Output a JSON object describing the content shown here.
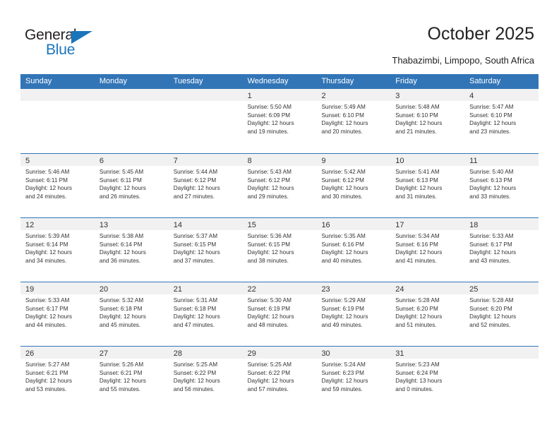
{
  "brand": {
    "name_top": "General",
    "name_bottom": "Blue",
    "accent_color": "#1b75bb"
  },
  "header": {
    "title": "October 2025",
    "subtitle": "Thabazimbi, Limpopo, South Africa"
  },
  "calendar": {
    "header_color": "#3275b7",
    "weekdays": [
      "Sunday",
      "Monday",
      "Tuesday",
      "Wednesday",
      "Thursday",
      "Friday",
      "Saturday"
    ],
    "weeks": [
      [
        {
          "day": "",
          "empty": true
        },
        {
          "day": "",
          "empty": true
        },
        {
          "day": "",
          "empty": true
        },
        {
          "day": "1",
          "sunrise": "Sunrise: 5:50 AM",
          "sunset": "Sunset: 6:09 PM",
          "daylight_line1": "Daylight: 12 hours",
          "daylight_line2": "and 19 minutes."
        },
        {
          "day": "2",
          "sunrise": "Sunrise: 5:49 AM",
          "sunset": "Sunset: 6:10 PM",
          "daylight_line1": "Daylight: 12 hours",
          "daylight_line2": "and 20 minutes."
        },
        {
          "day": "3",
          "sunrise": "Sunrise: 5:48 AM",
          "sunset": "Sunset: 6:10 PM",
          "daylight_line1": "Daylight: 12 hours",
          "daylight_line2": "and 21 minutes."
        },
        {
          "day": "4",
          "sunrise": "Sunrise: 5:47 AM",
          "sunset": "Sunset: 6:10 PM",
          "daylight_line1": "Daylight: 12 hours",
          "daylight_line2": "and 23 minutes."
        }
      ],
      [
        {
          "day": "5",
          "sunrise": "Sunrise: 5:46 AM",
          "sunset": "Sunset: 6:11 PM",
          "daylight_line1": "Daylight: 12 hours",
          "daylight_line2": "and 24 minutes."
        },
        {
          "day": "6",
          "sunrise": "Sunrise: 5:45 AM",
          "sunset": "Sunset: 6:11 PM",
          "daylight_line1": "Daylight: 12 hours",
          "daylight_line2": "and 26 minutes."
        },
        {
          "day": "7",
          "sunrise": "Sunrise: 5:44 AM",
          "sunset": "Sunset: 6:12 PM",
          "daylight_line1": "Daylight: 12 hours",
          "daylight_line2": "and 27 minutes."
        },
        {
          "day": "8",
          "sunrise": "Sunrise: 5:43 AM",
          "sunset": "Sunset: 6:12 PM",
          "daylight_line1": "Daylight: 12 hours",
          "daylight_line2": "and 29 minutes."
        },
        {
          "day": "9",
          "sunrise": "Sunrise: 5:42 AM",
          "sunset": "Sunset: 6:12 PM",
          "daylight_line1": "Daylight: 12 hours",
          "daylight_line2": "and 30 minutes."
        },
        {
          "day": "10",
          "sunrise": "Sunrise: 5:41 AM",
          "sunset": "Sunset: 6:13 PM",
          "daylight_line1": "Daylight: 12 hours",
          "daylight_line2": "and 31 minutes."
        },
        {
          "day": "11",
          "sunrise": "Sunrise: 5:40 AM",
          "sunset": "Sunset: 6:13 PM",
          "daylight_line1": "Daylight: 12 hours",
          "daylight_line2": "and 33 minutes."
        }
      ],
      [
        {
          "day": "12",
          "sunrise": "Sunrise: 5:39 AM",
          "sunset": "Sunset: 6:14 PM",
          "daylight_line1": "Daylight: 12 hours",
          "daylight_line2": "and 34 minutes."
        },
        {
          "day": "13",
          "sunrise": "Sunrise: 5:38 AM",
          "sunset": "Sunset: 6:14 PM",
          "daylight_line1": "Daylight: 12 hours",
          "daylight_line2": "and 36 minutes."
        },
        {
          "day": "14",
          "sunrise": "Sunrise: 5:37 AM",
          "sunset": "Sunset: 6:15 PM",
          "daylight_line1": "Daylight: 12 hours",
          "daylight_line2": "and 37 minutes."
        },
        {
          "day": "15",
          "sunrise": "Sunrise: 5:36 AM",
          "sunset": "Sunset: 6:15 PM",
          "daylight_line1": "Daylight: 12 hours",
          "daylight_line2": "and 38 minutes."
        },
        {
          "day": "16",
          "sunrise": "Sunrise: 5:35 AM",
          "sunset": "Sunset: 6:16 PM",
          "daylight_line1": "Daylight: 12 hours",
          "daylight_line2": "and 40 minutes."
        },
        {
          "day": "17",
          "sunrise": "Sunrise: 5:34 AM",
          "sunset": "Sunset: 6:16 PM",
          "daylight_line1": "Daylight: 12 hours",
          "daylight_line2": "and 41 minutes."
        },
        {
          "day": "18",
          "sunrise": "Sunrise: 5:33 AM",
          "sunset": "Sunset: 6:17 PM",
          "daylight_line1": "Daylight: 12 hours",
          "daylight_line2": "and 43 minutes."
        }
      ],
      [
        {
          "day": "19",
          "sunrise": "Sunrise: 5:33 AM",
          "sunset": "Sunset: 6:17 PM",
          "daylight_line1": "Daylight: 12 hours",
          "daylight_line2": "and 44 minutes."
        },
        {
          "day": "20",
          "sunrise": "Sunrise: 5:32 AM",
          "sunset": "Sunset: 6:18 PM",
          "daylight_line1": "Daylight: 12 hours",
          "daylight_line2": "and 45 minutes."
        },
        {
          "day": "21",
          "sunrise": "Sunrise: 5:31 AM",
          "sunset": "Sunset: 6:18 PM",
          "daylight_line1": "Daylight: 12 hours",
          "daylight_line2": "and 47 minutes."
        },
        {
          "day": "22",
          "sunrise": "Sunrise: 5:30 AM",
          "sunset": "Sunset: 6:19 PM",
          "daylight_line1": "Daylight: 12 hours",
          "daylight_line2": "and 48 minutes."
        },
        {
          "day": "23",
          "sunrise": "Sunrise: 5:29 AM",
          "sunset": "Sunset: 6:19 PM",
          "daylight_line1": "Daylight: 12 hours",
          "daylight_line2": "and 49 minutes."
        },
        {
          "day": "24",
          "sunrise": "Sunrise: 5:28 AM",
          "sunset": "Sunset: 6:20 PM",
          "daylight_line1": "Daylight: 12 hours",
          "daylight_line2": "and 51 minutes."
        },
        {
          "day": "25",
          "sunrise": "Sunrise: 5:28 AM",
          "sunset": "Sunset: 6:20 PM",
          "daylight_line1": "Daylight: 12 hours",
          "daylight_line2": "and 52 minutes."
        }
      ],
      [
        {
          "day": "26",
          "sunrise": "Sunrise: 5:27 AM",
          "sunset": "Sunset: 6:21 PM",
          "daylight_line1": "Daylight: 12 hours",
          "daylight_line2": "and 53 minutes."
        },
        {
          "day": "27",
          "sunrise": "Sunrise: 5:26 AM",
          "sunset": "Sunset: 6:21 PM",
          "daylight_line1": "Daylight: 12 hours",
          "daylight_line2": "and 55 minutes."
        },
        {
          "day": "28",
          "sunrise": "Sunrise: 5:25 AM",
          "sunset": "Sunset: 6:22 PM",
          "daylight_line1": "Daylight: 12 hours",
          "daylight_line2": "and 56 minutes."
        },
        {
          "day": "29",
          "sunrise": "Sunrise: 5:25 AM",
          "sunset": "Sunset: 6:22 PM",
          "daylight_line1": "Daylight: 12 hours",
          "daylight_line2": "and 57 minutes."
        },
        {
          "day": "30",
          "sunrise": "Sunrise: 5:24 AM",
          "sunset": "Sunset: 6:23 PM",
          "daylight_line1": "Daylight: 12 hours",
          "daylight_line2": "and 59 minutes."
        },
        {
          "day": "31",
          "sunrise": "Sunrise: 5:23 AM",
          "sunset": "Sunset: 6:24 PM",
          "daylight_line1": "Daylight: 13 hours",
          "daylight_line2": "and 0 minutes."
        },
        {
          "day": "",
          "empty": true
        }
      ]
    ]
  }
}
